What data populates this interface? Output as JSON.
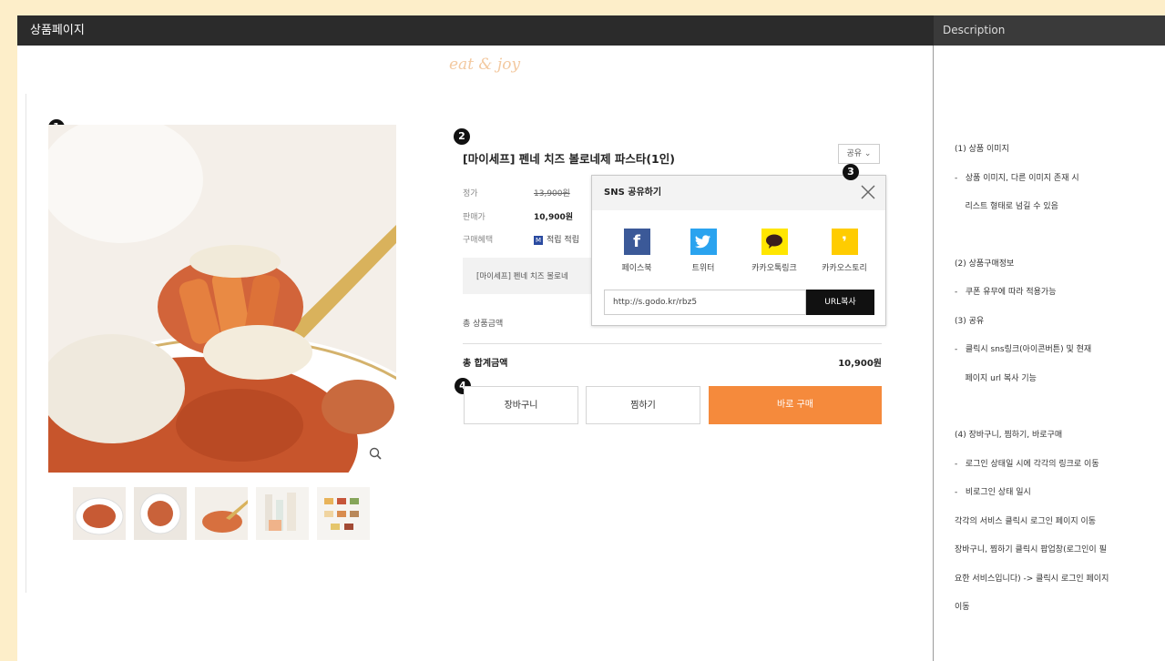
{
  "header": {
    "title": "상품페이지",
    "description_title": "Description"
  },
  "logo": "eat & joy",
  "markers": [
    "1",
    "2",
    "3",
    "4"
  ],
  "product": {
    "title": "[마이세프] 펜네 치즈 볼로네제 파스타(1인)",
    "share_button": "공유 ⌄",
    "list_price_label": "정가",
    "list_price": "13,900원",
    "sale_price_label": "판매가",
    "sale_price": "10,900원",
    "benefit_label": "구매혜택",
    "benefit_badge": "M",
    "benefit_text": "적립 적립",
    "option_text": "[마이세프] 펜네 치즈 볼로네",
    "subtotal_label": "총 상품금액",
    "total_label": "총 합계금액",
    "total_value": "10,900원"
  },
  "buttons": {
    "cart": "장바구니",
    "wishlist": "찜하기",
    "buy_now": "바로 구매"
  },
  "sns_popup": {
    "title": "SNS 공유하기",
    "items": [
      {
        "label": "페이스북",
        "icon": "facebook-icon",
        "color": "#3b5998",
        "glyph": "f"
      },
      {
        "label": "트위터",
        "icon": "twitter-icon",
        "color": "#2aa3ef",
        "glyph": "🐦"
      },
      {
        "label": "카카오톡링크",
        "icon": "kakaotalk-icon",
        "color": "#ffe600",
        "glyph": "💬"
      },
      {
        "label": "카카오스토리",
        "icon": "kakaostory-icon",
        "color": "#ffcc00",
        "glyph": "❜"
      }
    ],
    "url": "http://s.godo.kr/rbz5",
    "url_copy_button": "URL복사"
  },
  "description": [
    "(1) 상품 이미지",
    "-   상품 이미지, 다른 이미지 존재 시",
    "    리스트 형태로 넘길 수 있음",
    "",
    "(2) 상품구매정보",
    "-   쿠폰 유무에 따라 적용가능",
    "(3) 공유",
    "-   클릭시 sns링크(아이콘버튼) 및 현재",
    "    페이지 url 복사 기능",
    "",
    "(4) 장바구니, 찜하기, 바로구매",
    "-   로그인 상태일 시에 각각의 링크로 이동",
    "-   비로그인 상태 일시",
    "각각의 서비스 클릭시 로그인 페이지 이동",
    "장바구니, 찜하기 클릭시 팝업창(로그인이 필",
    "요한 서비스입니다) -> 클릭시 로그인 페이지",
    "이동"
  ],
  "colors": {
    "accent": "#f58a3c",
    "topbar": "#2b2b2b",
    "page_bg": "#fdeec9"
  }
}
